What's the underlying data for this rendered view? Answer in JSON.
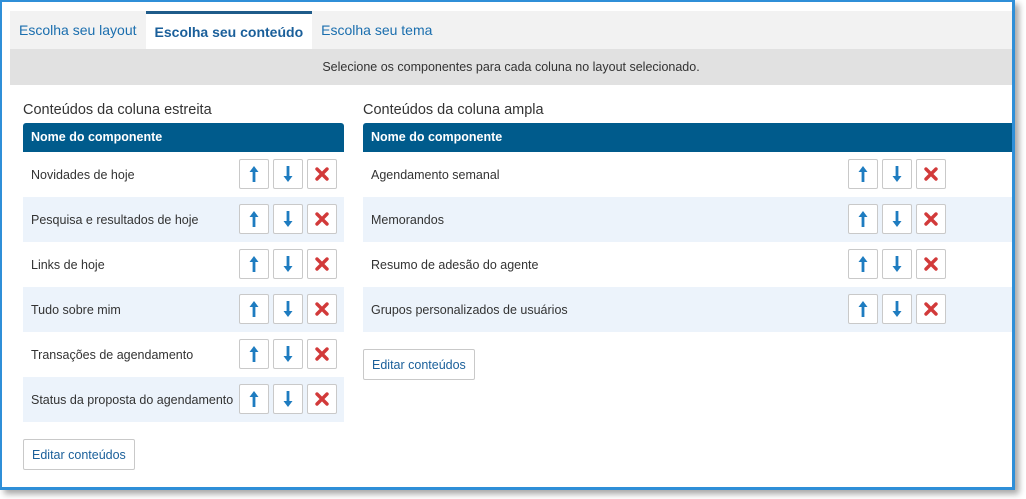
{
  "tabs": [
    {
      "label": "Escolha seu layout",
      "active": false
    },
    {
      "label": "Escolha seu conteúdo",
      "active": true
    },
    {
      "label": "Escolha seu tema",
      "active": false
    }
  ],
  "instruction": "Selecione os componentes para cada coluna no layout selecionado.",
  "narrow_column": {
    "title": "Conteúdos da coluna estreita",
    "header": "Nome do componente",
    "items": [
      "Novidades de hoje",
      "Pesquisa e resultados de hoje",
      "Links de hoje",
      "Tudo sobre mim",
      "Transações de agendamento",
      "Status da proposta do agendamento"
    ],
    "edit_label": "Editar conteúdos"
  },
  "wide_column": {
    "title": "Conteúdos da coluna ampla",
    "header": "Nome do componente",
    "items": [
      "Agendamento semanal",
      "Memorandos",
      "Resumo de adesão do agente",
      "Grupos personalizados de usuários"
    ],
    "edit_label": "Editar conteúdos"
  },
  "icons": {
    "move_up": "arrow-up-icon",
    "move_down": "arrow-down-icon",
    "remove": "close-x-icon"
  },
  "colors": {
    "header_bg": "#005b8c",
    "link": "#1a6eae",
    "arrow": "#1e7cc0",
    "remove": "#d23a3a",
    "alt_row": "#ecf3fb",
    "frame": "#2f8fd8"
  }
}
